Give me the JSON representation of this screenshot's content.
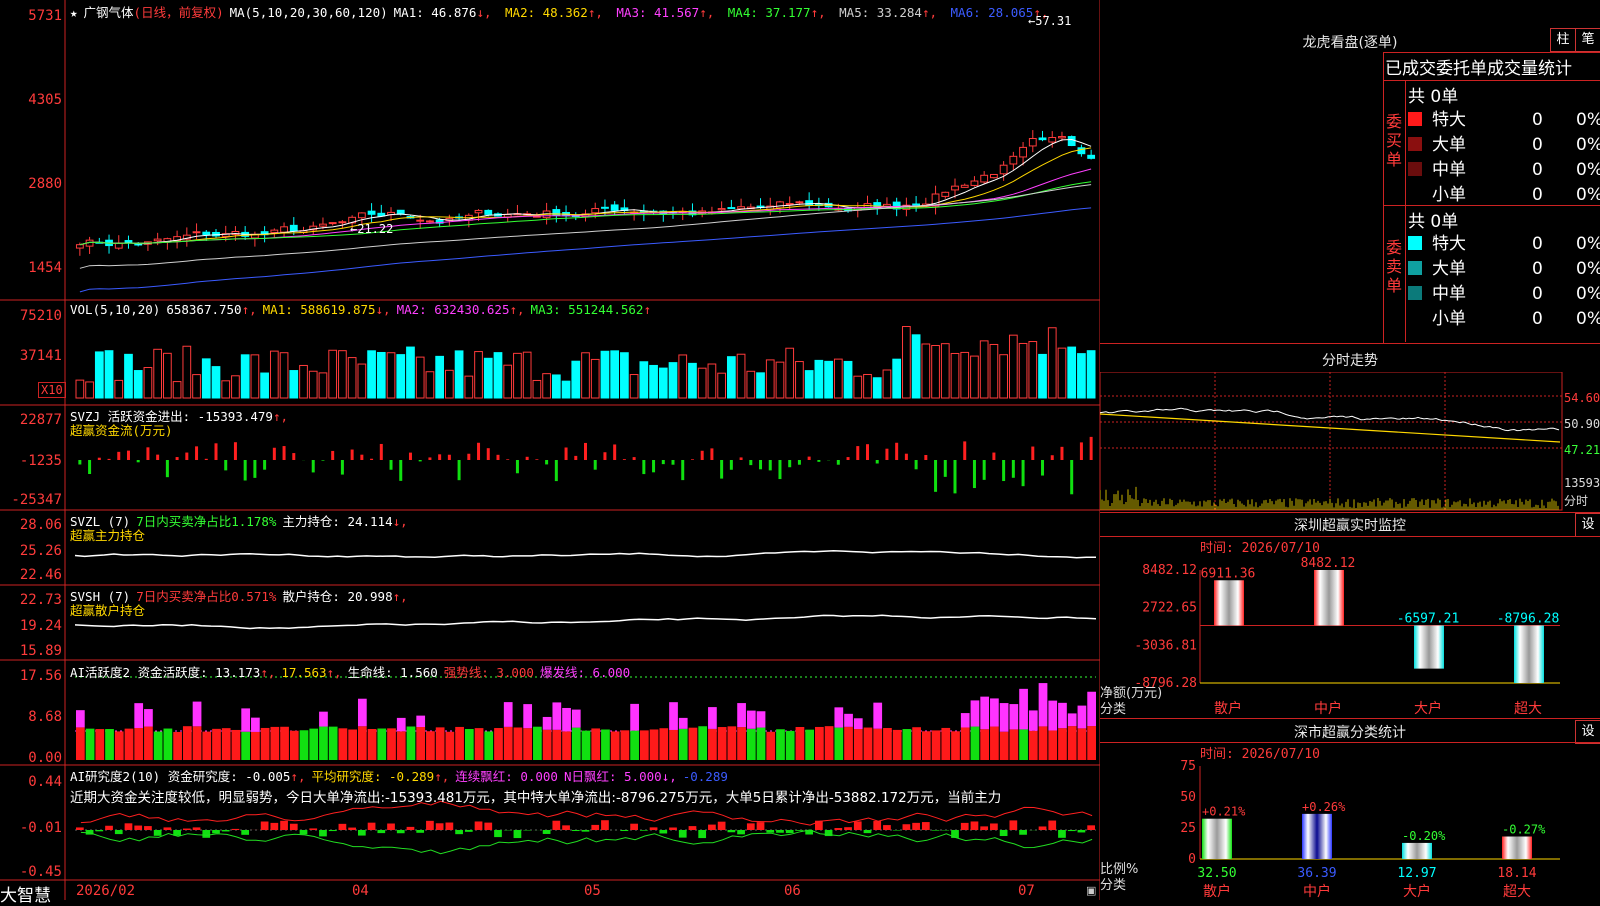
{
  "stock": {
    "name": "广钢气体",
    "mode": "(日线，前复权)",
    "ma_prefix": "MA(5,10,20,30,60,120)",
    "mas": [
      {
        "label": "MA1: 46.876",
        "arrow": "↓",
        "color": "#ffffff"
      },
      {
        "label": "MA2: 48.362",
        "arrow": "↑",
        "color": "#ffd800"
      },
      {
        "label": "MA3: 41.567",
        "arrow": "↑",
        "color": "#ff40ff"
      },
      {
        "label": "MA4: 37.177",
        "arrow": "↑",
        "color": "#33ff33"
      },
      {
        "label": "MA5: 33.284",
        "arrow": "↑",
        "color": "#cfcfcf"
      },
      {
        "label": "MA6: 28.065",
        "arrow": "↑",
        "color": "#3b5bff"
      }
    ],
    "high_mark": "57.31",
    "low_mark": "21.22",
    "price_axis": [
      "5731",
      "4305",
      "2880",
      "1454"
    ]
  },
  "vol": {
    "header": "VOL(5,10,20)",
    "value": "658367.750",
    "ma1": "MA1: 588619.875",
    "ma2": "MA2: 632430.625",
    "ma3": "MA3: 551244.562",
    "axis": [
      "75210",
      "37141"
    ],
    "unit": "X10"
  },
  "svzj": {
    "header": "SVZJ  活跃资金进出: -15393.479",
    "sub": "超赢资金流(万元)",
    "axis": [
      "22877",
      "-1235",
      "-25347"
    ]
  },
  "svzl": {
    "header": "SVZL (7)",
    "mid": "7日内买卖净占比1.178%",
    "hold": "主力持仓: 24.114",
    "sub": "超赢主力持仓",
    "axis": [
      "28.06",
      "25.26",
      "22.46"
    ]
  },
  "svsh": {
    "header": "SVSH (7)",
    "mid": "7日内买卖净占比0.571%",
    "hold": "散户持仓: 20.998",
    "sub": "超赢散户持仓",
    "axis": [
      "22.73",
      "19.24",
      "15.89"
    ]
  },
  "ai1": {
    "header": "AI活跃度2 资金活跃度: 13.173",
    "v2": "17.563",
    "life": "生命线: 1.560",
    "strong": "强势线: 3.000",
    "burst": "爆发线: 6.000",
    "axis": [
      "17.56",
      "8.68",
      "0.00"
    ]
  },
  "ai2": {
    "header": "AI研究度2(10) 资金研究度: -0.005",
    "avg": "平均研究度: -0.289",
    "cont": "连续飘红: 0.000",
    "nday": "N日飘红: 5.000",
    "last": "-0.289",
    "text": "近期大资金关注度较低，明显弱势，今日大单净流出:-15393.481万元，其中特大单净流出:-8796.275万元，大单5日累计净出-53882.172万元，当前主力",
    "axis": [
      "0.44",
      "-0.01",
      "-0.45"
    ]
  },
  "xaxis": {
    "brand": "大智慧",
    "dates": [
      "2026/02",
      "04",
      "05",
      "06",
      "07"
    ]
  },
  "lhb": {
    "title": "龙虎看盘(逐单)",
    "btn1": "柱",
    "btn2": "笔",
    "subtitle": "已成交委托单成交量统计",
    "buy_label": "委买单",
    "sell_label": "委卖单",
    "buy_total": "共 0单",
    "sell_total": "共 0单",
    "buy": [
      {
        "name": "特大",
        "n": "0",
        "pct": "0%",
        "color": "#ff1a1a"
      },
      {
        "name": "大单",
        "n": "0",
        "pct": "0%",
        "color": "#8a0f0f"
      },
      {
        "name": "中单",
        "n": "0",
        "pct": "0%",
        "color": "#6a0d0d"
      },
      {
        "name": "小单",
        "n": "0",
        "pct": "0%",
        "color": ""
      }
    ],
    "sell": [
      {
        "name": "特大",
        "n": "0",
        "pct": "0%",
        "color": "#00ffff"
      },
      {
        "name": "大单",
        "n": "0",
        "pct": "0%",
        "color": "#0fa0a0"
      },
      {
        "name": "中单",
        "n": "0",
        "pct": "0%",
        "color": "#0b7a7a"
      },
      {
        "name": "小单",
        "n": "0",
        "pct": "0%",
        "color": ""
      }
    ]
  },
  "intraday": {
    "title": "分时走势",
    "axis": [
      "54.60",
      "50.90",
      "47.21",
      "13593"
    ],
    "bottom": "分时"
  },
  "sz_rt": {
    "title": "深圳超赢实时监控",
    "btn": "设",
    "time": "时间: 2026/07/10",
    "axis": [
      "8482.12",
      "2722.65",
      "-3036.81",
      "-8796.28"
    ],
    "ylabel": "净额(万元)",
    "xlabel": "分类",
    "bars": [
      {
        "cat": "散户",
        "value": 6911.36,
        "label": "6911.36"
      },
      {
        "cat": "中户",
        "value": 8482.12,
        "label": "8482.12"
      },
      {
        "cat": "大户",
        "value": -6597.21,
        "label": "-6597.21"
      },
      {
        "cat": "超大",
        "value": -8796.28,
        "label": "-8796.28"
      }
    ]
  },
  "sz_cls": {
    "title": "深市超赢分类统计",
    "btn": "设",
    "time": "时间: 2026/07/10",
    "axis": [
      "75",
      "50",
      "25",
      "0"
    ],
    "ylabel": "比例%",
    "xlabel": "分类",
    "bars": [
      {
        "cat": "散户",
        "value": 32.5,
        "label": "32.50",
        "chg": "+0.21%"
      },
      {
        "cat": "中户",
        "value": 36.39,
        "label": "36.39",
        "chg": "+0.26%"
      },
      {
        "cat": "大户",
        "value": 12.97,
        "label": "12.97",
        "chg": "-0.20%"
      },
      {
        "cat": "超大",
        "value": 18.14,
        "label": "18.14",
        "chg": "-0.27%"
      }
    ]
  },
  "chart_data": [
    {
      "type": "bar",
      "title": "深圳超赢实时监控",
      "ylabel": "净额(万元)",
      "xlabel": "分类",
      "categories": [
        "散户",
        "中户",
        "大户",
        "超大"
      ],
      "values": [
        6911.36,
        8482.12,
        -6597.21,
        -8796.28
      ],
      "ylim": [
        -8796.28,
        8482.12
      ]
    },
    {
      "type": "bar",
      "title": "深市超赢分类统计",
      "ylabel": "比例%",
      "xlabel": "分类",
      "categories": [
        "散户",
        "中户",
        "大户",
        "超大"
      ],
      "values": [
        32.5,
        36.39,
        12.97,
        18.14
      ],
      "ylim": [
        0,
        75
      ]
    }
  ]
}
